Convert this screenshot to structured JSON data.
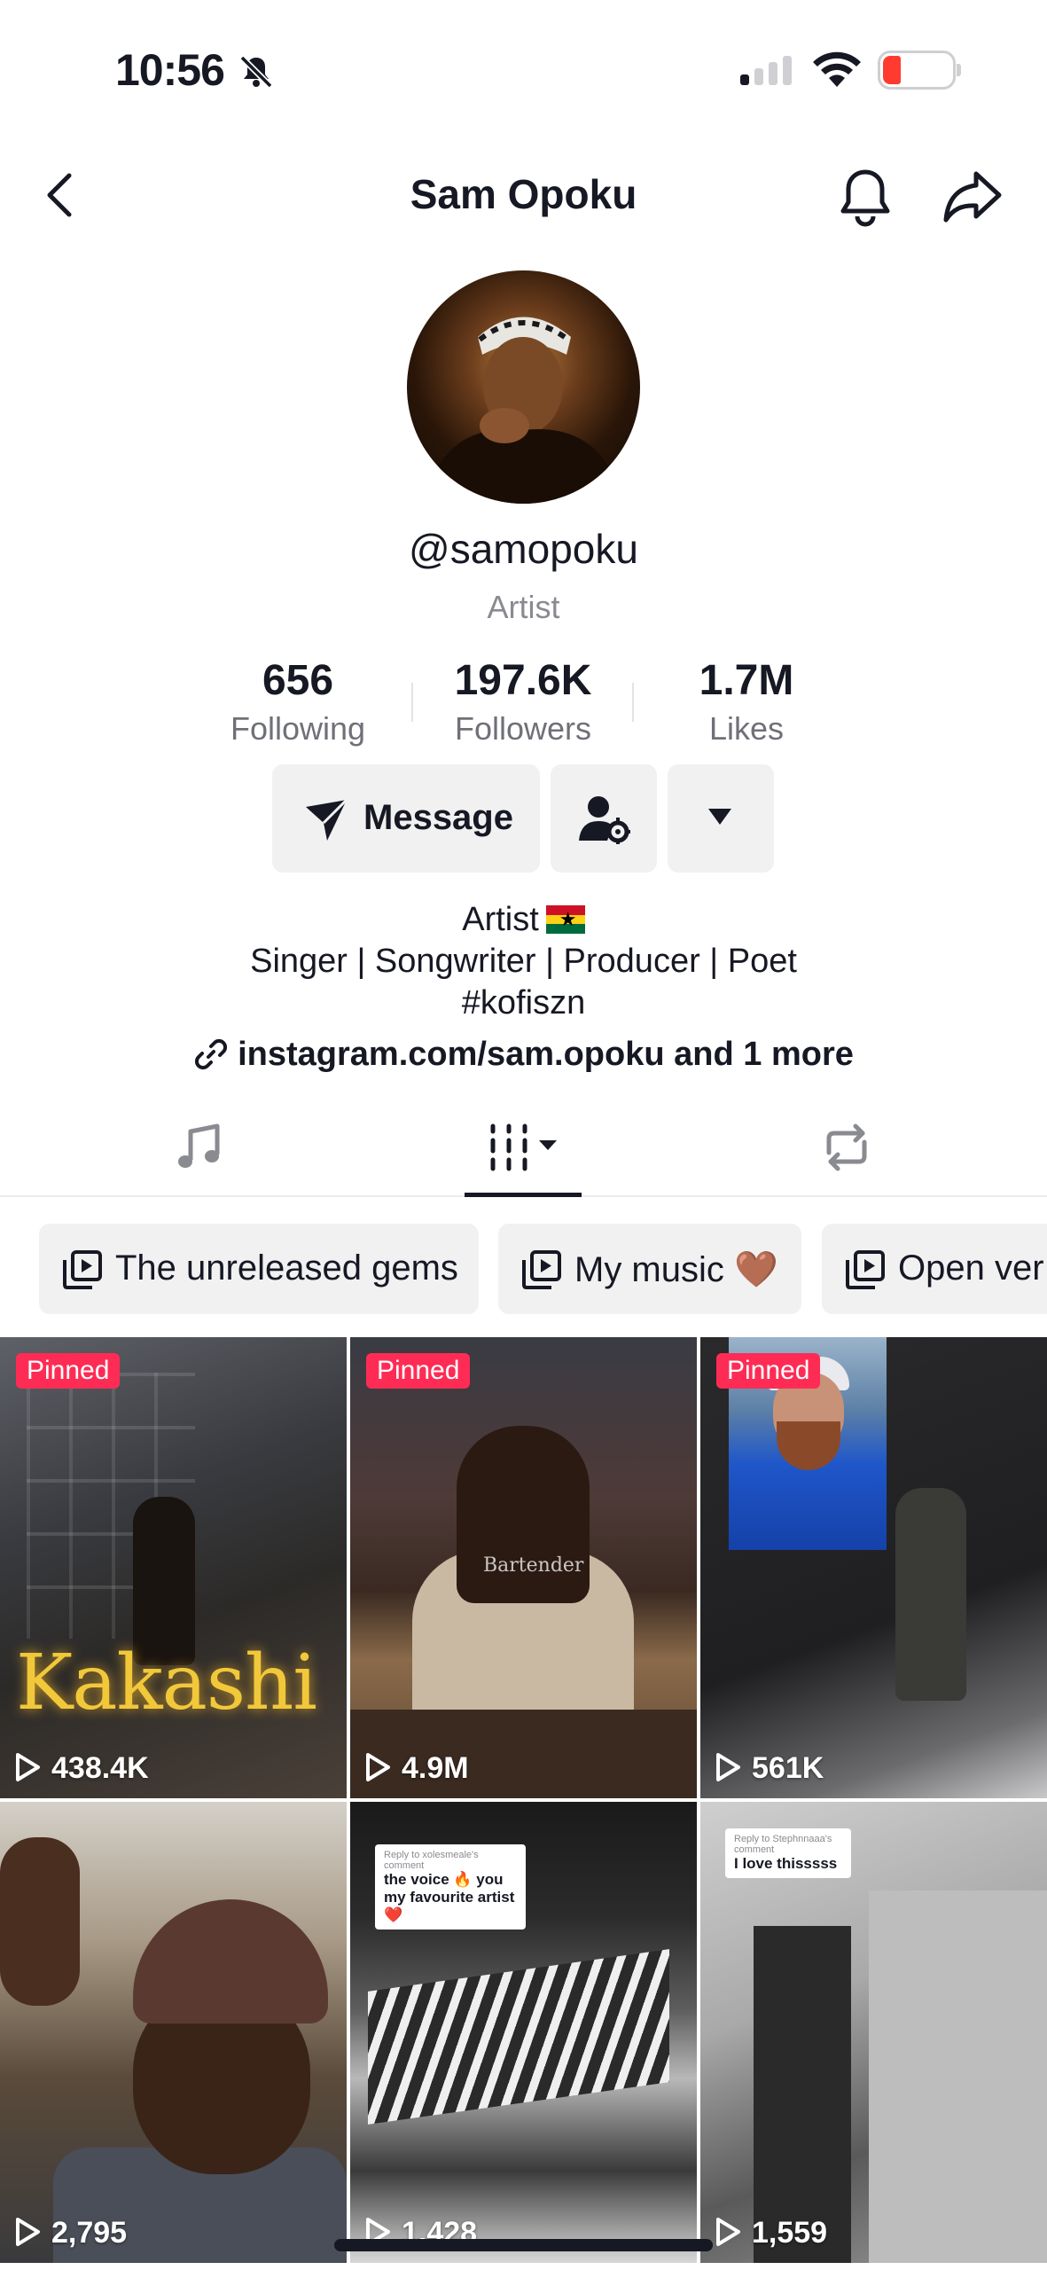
{
  "status_bar": {
    "time": "10:56",
    "battery": "20"
  },
  "header": {
    "title": "Sam Opoku"
  },
  "profile": {
    "username": "@samopoku",
    "category": "Artist",
    "stats": [
      {
        "value": "656",
        "label": "Following"
      },
      {
        "value": "197.6K",
        "label": "Followers"
      },
      {
        "value": "1.7M",
        "label": "Likes"
      }
    ],
    "message_label": "Message",
    "bio": {
      "line1": "Artist",
      "line2": "Singer | Songwriter | Producer | Poet",
      "line3": "#kofiszn"
    },
    "link": {
      "url": "instagram.com/sam.opoku",
      "more": " and 1 more"
    }
  },
  "playlists": [
    {
      "label": "The unreleased gems"
    },
    {
      "label": "My music 🤎"
    },
    {
      "label": "Open ver"
    }
  ],
  "videos": [
    {
      "pinned": "Pinned",
      "views": "438.4K",
      "overlay": "Kakashi"
    },
    {
      "pinned": "Pinned",
      "views": "4.9M",
      "overlay": "Bartender"
    },
    {
      "pinned": "Pinned",
      "views": "561K"
    },
    {
      "views": "2,795"
    },
    {
      "views": "1,428",
      "comment_reply": "Reply to xolesmeale's comment",
      "comment_text": "the voice 🔥 you my favourite artist ❤️"
    },
    {
      "views": "1,559",
      "comment_reply": "Reply to Stephnnaaa's comment",
      "comment_text": "I love thisssss"
    }
  ],
  "colors": {
    "pinned_badge": "#fe2c55",
    "text": "#161823",
    "muted": "#8a8b91"
  }
}
